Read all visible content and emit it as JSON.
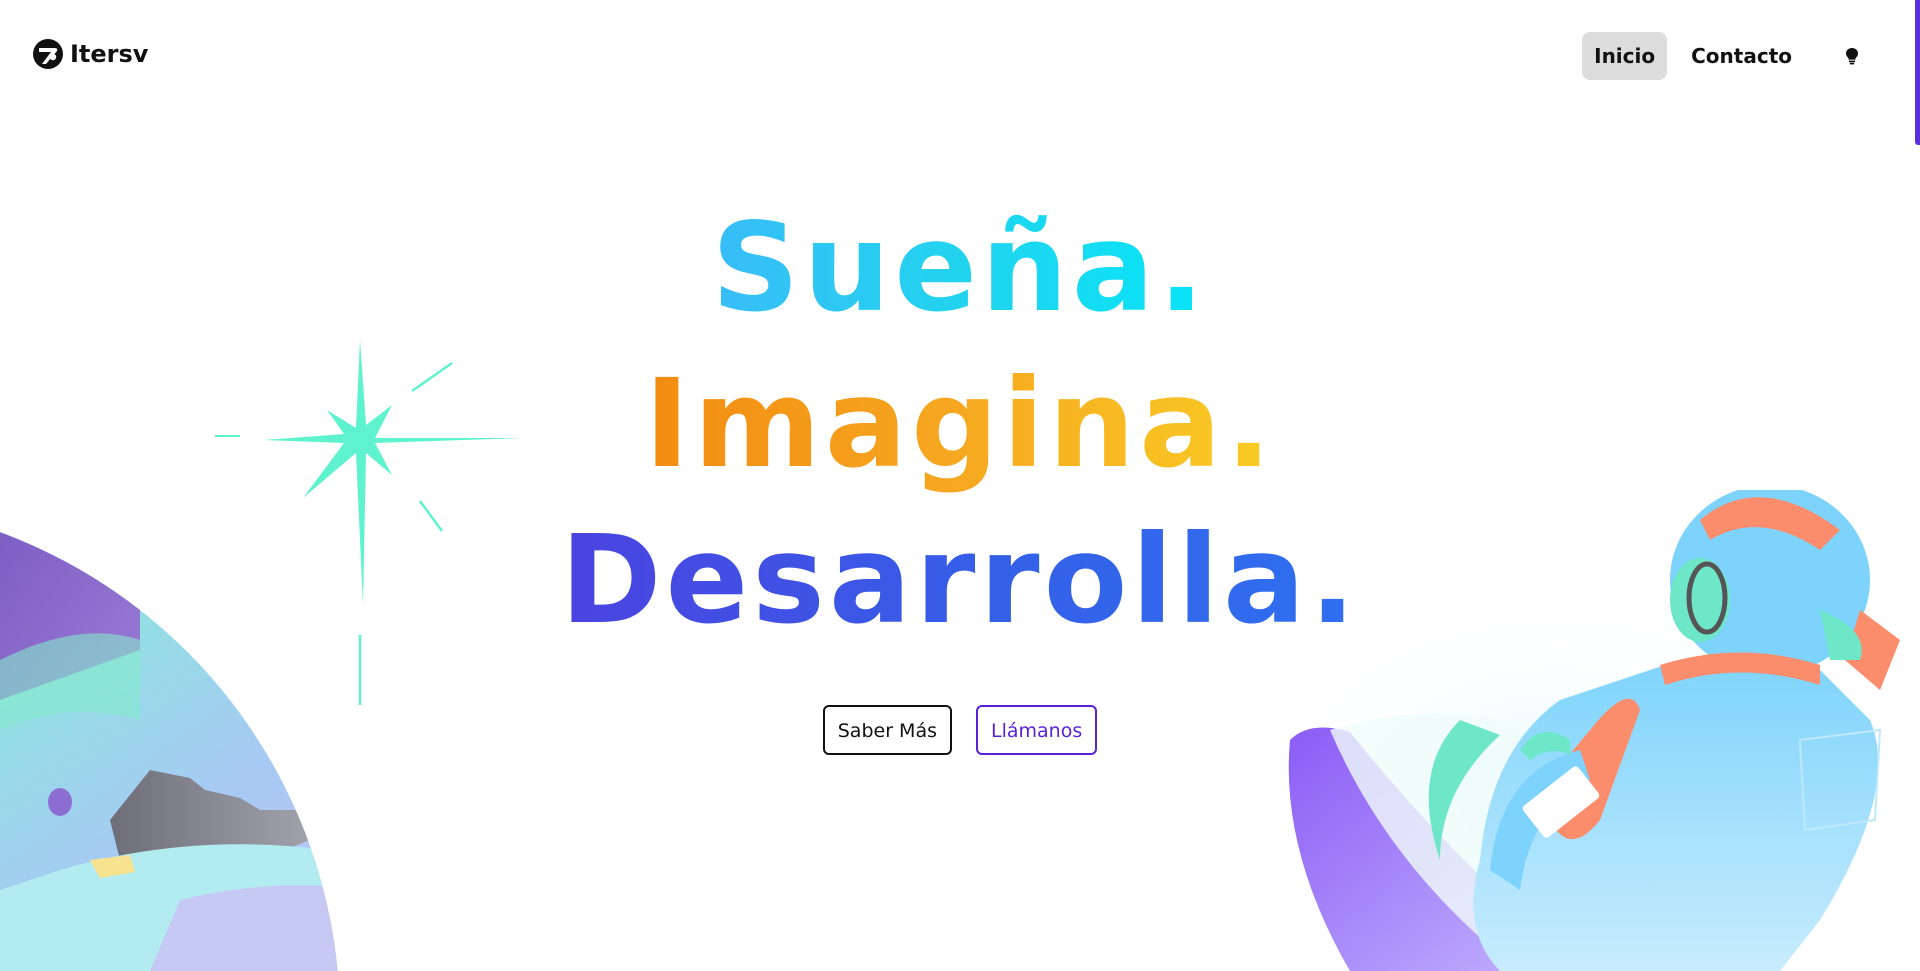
{
  "brand": {
    "name": "Itersv",
    "logo_icon": "itersv-logo-icon"
  },
  "nav": {
    "items": [
      {
        "label": "Inicio",
        "active": true
      },
      {
        "label": "Contacto",
        "active": false
      }
    ],
    "theme_toggle_icon": "lightbulb-icon"
  },
  "hero": {
    "lines": [
      "Sueña.",
      "Imagina.",
      "Desarrolla."
    ],
    "buttons": {
      "primary_label": "Saber Más",
      "secondary_label": "Llámanos"
    }
  },
  "colors": {
    "line1": "#22d3ee",
    "line2": "#f6a820",
    "line3": "#3b5ce8",
    "accent": "#5b21d6",
    "sparkle": "#5ef2cf"
  }
}
